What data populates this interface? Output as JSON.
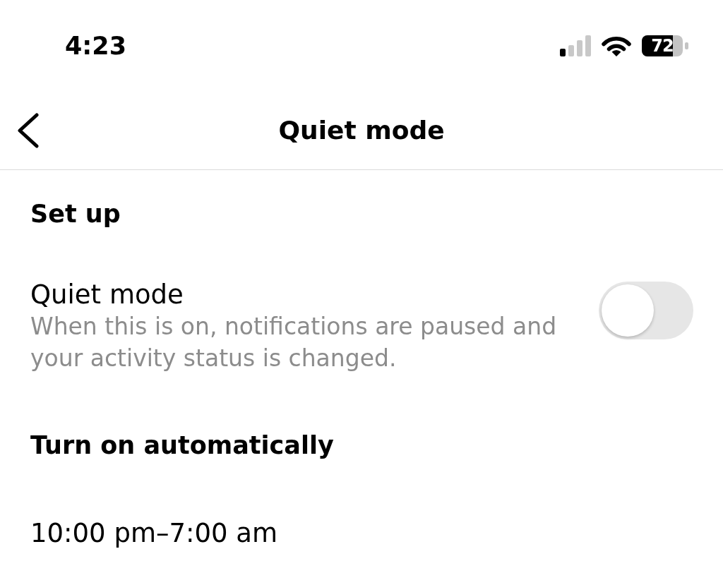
{
  "status_bar": {
    "time": "4:23",
    "battery_percent": "72"
  },
  "header": {
    "title": "Quiet mode"
  },
  "sections": [
    {
      "heading": "Set up",
      "items": [
        {
          "kind": "toggle",
          "label": "Quiet mode",
          "description": "When this is on, notifications are paused and your activity status is changed.",
          "on": false
        }
      ]
    },
    {
      "heading": "Turn on automatically",
      "items": [
        {
          "kind": "schedule",
          "label": "10:00 pm–7:00 am"
        }
      ]
    }
  ]
}
